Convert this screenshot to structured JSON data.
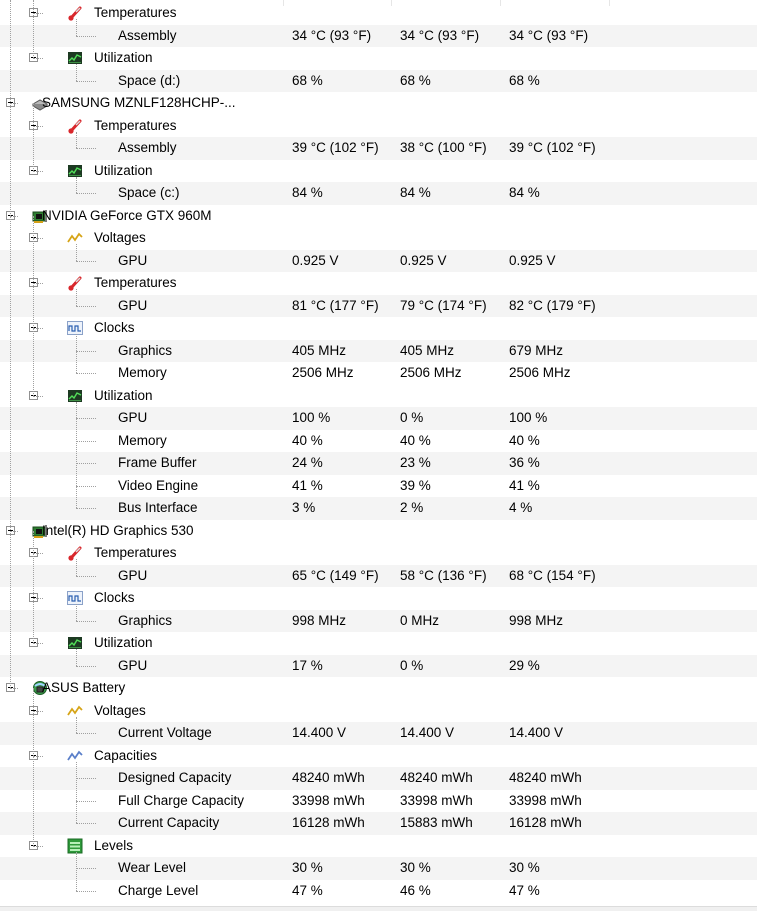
{
  "rows": [
    {
      "level": 1,
      "kind": "category",
      "icon": "thermometer-icon",
      "label": "Temperatures"
    },
    {
      "level": 2,
      "kind": "sensor",
      "label": "Assembly",
      "values": [
        "34 °C  (93 °F)",
        "34 °C  (93 °F)",
        "34 °C  (93 °F)"
      ]
    },
    {
      "level": 1,
      "kind": "category",
      "icon": "utilization-icon",
      "label": "Utilization"
    },
    {
      "level": 2,
      "kind": "sensor",
      "label": "Space (d:)",
      "values": [
        "68 %",
        "68 %",
        "68 %"
      ]
    },
    {
      "level": 0,
      "kind": "device",
      "icon": "disk-drive-icon",
      "label": "SAMSUNG MZNLF128HCHP-..."
    },
    {
      "level": 1,
      "kind": "category",
      "icon": "thermometer-icon",
      "label": "Temperatures"
    },
    {
      "level": 2,
      "kind": "sensor",
      "label": "Assembly",
      "values": [
        "39 °C  (102 °F)",
        "38 °C  (100 °F)",
        "39 °C  (102 °F)"
      ]
    },
    {
      "level": 1,
      "kind": "category",
      "icon": "utilization-icon",
      "label": "Utilization"
    },
    {
      "level": 2,
      "kind": "sensor",
      "label": "Space (c:)",
      "values": [
        "84 %",
        "84 %",
        "84 %"
      ]
    },
    {
      "level": 0,
      "kind": "device",
      "icon": "graphics-card-icon",
      "label": "NVIDIA GeForce GTX 960M"
    },
    {
      "level": 1,
      "kind": "category",
      "icon": "voltage-icon",
      "label": "Voltages"
    },
    {
      "level": 2,
      "kind": "sensor",
      "label": "GPU",
      "values": [
        "0.925 V",
        "0.925 V",
        "0.925 V"
      ]
    },
    {
      "level": 1,
      "kind": "category",
      "icon": "thermometer-icon",
      "label": "Temperatures"
    },
    {
      "level": 2,
      "kind": "sensor",
      "label": "GPU",
      "values": [
        "81 °C  (177 °F)",
        "79 °C  (174 °F)",
        "82 °C  (179 °F)"
      ]
    },
    {
      "level": 1,
      "kind": "category",
      "icon": "clock-icon",
      "label": "Clocks"
    },
    {
      "level": 2,
      "kind": "sensor",
      "label": "Graphics",
      "values": [
        "405 MHz",
        "405 MHz",
        "679 MHz"
      ]
    },
    {
      "level": 2,
      "kind": "sensor",
      "label": "Memory",
      "values": [
        "2506 MHz",
        "2506 MHz",
        "2506 MHz"
      ]
    },
    {
      "level": 1,
      "kind": "category",
      "icon": "utilization-icon",
      "label": "Utilization"
    },
    {
      "level": 2,
      "kind": "sensor",
      "label": "GPU",
      "values": [
        "100 %",
        "0 %",
        "100 %"
      ]
    },
    {
      "level": 2,
      "kind": "sensor",
      "label": "Memory",
      "values": [
        "40 %",
        "40 %",
        "40 %"
      ]
    },
    {
      "level": 2,
      "kind": "sensor",
      "label": "Frame Buffer",
      "values": [
        "24 %",
        "23 %",
        "36 %"
      ]
    },
    {
      "level": 2,
      "kind": "sensor",
      "label": "Video Engine",
      "values": [
        "41 %",
        "39 %",
        "41 %"
      ]
    },
    {
      "level": 2,
      "kind": "sensor",
      "label": "Bus Interface",
      "values": [
        "3 %",
        "2 %",
        "4 %"
      ]
    },
    {
      "level": 0,
      "kind": "device",
      "icon": "graphics-card-icon",
      "label": "Intel(R) HD Graphics 530"
    },
    {
      "level": 1,
      "kind": "category",
      "icon": "thermometer-icon",
      "label": "Temperatures"
    },
    {
      "level": 2,
      "kind": "sensor",
      "label": "GPU",
      "values": [
        "65 °C  (149 °F)",
        "58 °C  (136 °F)",
        "68 °C  (154 °F)"
      ]
    },
    {
      "level": 1,
      "kind": "category",
      "icon": "clock-icon",
      "label": "Clocks"
    },
    {
      "level": 2,
      "kind": "sensor",
      "label": "Graphics",
      "values": [
        "998 MHz",
        "0 MHz",
        "998 MHz"
      ]
    },
    {
      "level": 1,
      "kind": "category",
      "icon": "utilization-icon",
      "label": "Utilization"
    },
    {
      "level": 2,
      "kind": "sensor",
      "label": "GPU",
      "values": [
        "17 %",
        "0 %",
        "29 %"
      ]
    },
    {
      "level": 0,
      "kind": "device",
      "icon": "battery-icon",
      "label": "ASUS Battery"
    },
    {
      "level": 1,
      "kind": "category",
      "icon": "voltage-icon",
      "label": "Voltages"
    },
    {
      "level": 2,
      "kind": "sensor",
      "label": "Current Voltage",
      "values": [
        "14.400 V",
        "14.400 V",
        "14.400 V"
      ]
    },
    {
      "level": 1,
      "kind": "category",
      "icon": "capacity-icon",
      "label": "Capacities"
    },
    {
      "level": 2,
      "kind": "sensor",
      "label": "Designed Capacity",
      "values": [
        "48240 mWh",
        "48240 mWh",
        "48240 mWh"
      ]
    },
    {
      "level": 2,
      "kind": "sensor",
      "label": "Full Charge Capacity",
      "values": [
        "33998 mWh",
        "33998 mWh",
        "33998 mWh"
      ]
    },
    {
      "level": 2,
      "kind": "sensor",
      "label": "Current Capacity",
      "values": [
        "16128 mWh",
        "15883 mWh",
        "16128 mWh"
      ]
    },
    {
      "level": 1,
      "kind": "category",
      "icon": "levels-icon",
      "label": "Levels"
    },
    {
      "level": 2,
      "kind": "sensor",
      "label": "Wear Level",
      "values": [
        "30 %",
        "30 %",
        "30 %"
      ]
    },
    {
      "level": 2,
      "kind": "sensor",
      "label": "Charge Level",
      "values": [
        "47 %",
        "46 %",
        "47 %"
      ]
    }
  ],
  "colors": {
    "alt_row": "#f4f4f4",
    "tree_lines": "#a0a0a0",
    "thermometer": "#d9262b",
    "voltage": "#d6a417",
    "chip": "#2f7d32"
  }
}
